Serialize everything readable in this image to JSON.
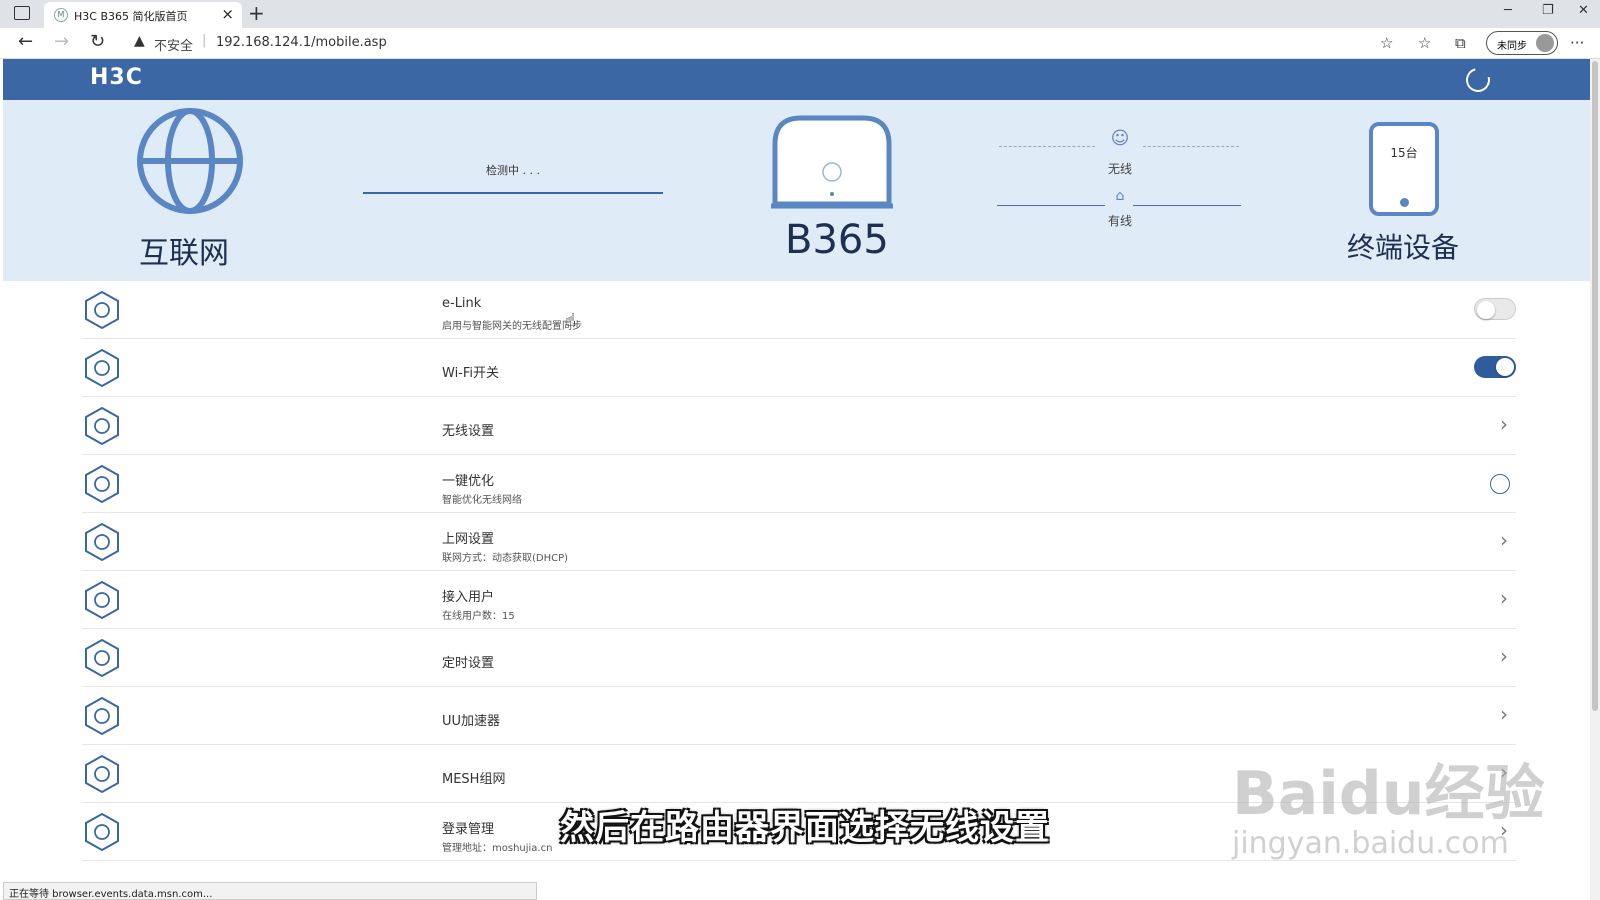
{
  "browser": {
    "tab_title": "H3C B365 简化版首页",
    "tab_favicon": "M",
    "security_label": "不安全",
    "url": "192.168.124.1/mobile.asp",
    "sync_label": "未同步"
  },
  "app": {
    "logo": "H3C",
    "accent": "#3b68a5"
  },
  "hero": {
    "internet_label": "互联网",
    "detect_status": "检测中 . . .",
    "router_model": "B365",
    "wireless_label": "无线",
    "wired_label": "有线",
    "device_count": "15台",
    "devices_label": "终端设备"
  },
  "settings": [
    {
      "title": "e-Link",
      "subtitle": "启用与智能网关的无线配置同步",
      "control": "toggle-off",
      "icon": "gear-icon"
    },
    {
      "title": "Wi-Fi开关",
      "subtitle": "",
      "control": "toggle-on",
      "icon": "wifi-icon"
    },
    {
      "title": "无线设置",
      "subtitle": "",
      "control": "chevron",
      "icon": "wifi-settings-icon"
    },
    {
      "title": "一键优化",
      "subtitle": "智能优化无线网络",
      "control": "action",
      "icon": "refresh-icon"
    },
    {
      "title": "上网设置",
      "subtitle": "联网方式：动态获取(DHCP)",
      "control": "chevron",
      "icon": "globe-settings-icon"
    },
    {
      "title": "接入用户",
      "subtitle": "在线用户数：15",
      "control": "chevron",
      "icon": "user-icon"
    },
    {
      "title": "定时设置",
      "subtitle": "",
      "control": "chevron",
      "icon": "alarm-clock-icon"
    },
    {
      "title": "UU加速器",
      "subtitle": "",
      "control": "chevron",
      "icon": "gamepad-icon"
    },
    {
      "title": "MESH组网",
      "subtitle": "",
      "control": "chevron",
      "icon": "mesh-icon"
    },
    {
      "title": "登录管理",
      "subtitle": "管理地址：moshujia.cn",
      "control": "chevron",
      "icon": "login-icon"
    }
  ],
  "overlay": {
    "caption": "然后在路由器界面选择无线设置",
    "watermark_brand": "Baidu经验",
    "watermark_url": "jingyan.baidu.com",
    "status_text": "正在等待 browser.events.data.msn.com..."
  }
}
